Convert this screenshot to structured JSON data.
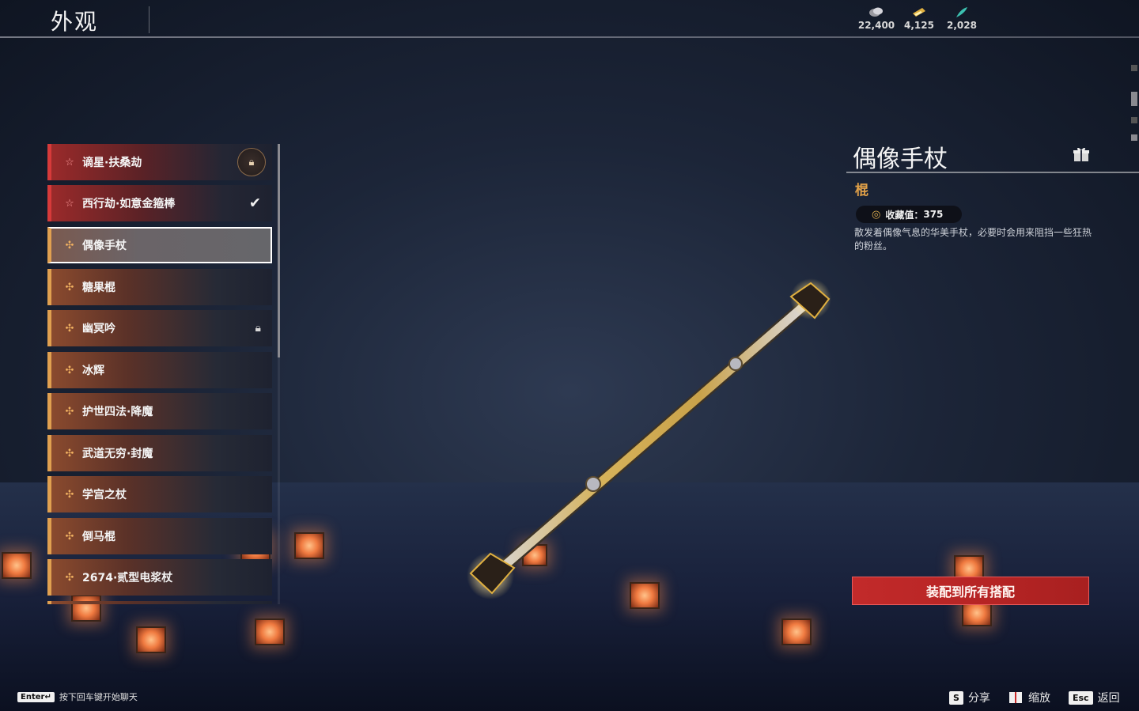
{
  "header": {
    "title": "外观",
    "currencies": [
      {
        "icon": "silver-coin-icon",
        "value": "22,400",
        "color": "#c8c8c8"
      },
      {
        "icon": "gold-ticket-icon",
        "value": "4,125",
        "color": "#e0b040"
      },
      {
        "icon": "cyan-feather-icon",
        "value": "2,028",
        "color": "#40c0b0"
      }
    ]
  },
  "list": {
    "items": [
      {
        "name": "谪星·扶桑劫",
        "marker": "star-icon",
        "status": "locked-circle"
      },
      {
        "name": "西行劫·如意金箍棒",
        "marker": "star-icon",
        "status": "equipped"
      },
      {
        "name": "偶像手杖",
        "marker": "cross-icon",
        "status": "selected"
      },
      {
        "name": "糖果棍",
        "marker": "cross-icon",
        "status": ""
      },
      {
        "name": "幽冥吟",
        "marker": "cross-icon",
        "status": "locked"
      },
      {
        "name": "冰辉",
        "marker": "cross-icon",
        "status": ""
      },
      {
        "name": "护世四法·降魔",
        "marker": "cross-icon",
        "status": ""
      },
      {
        "name": "武道无穷·封魔",
        "marker": "cross-icon",
        "status": ""
      },
      {
        "name": "学宫之杖",
        "marker": "cross-icon",
        "status": ""
      },
      {
        "name": "倒马棍",
        "marker": "cross-icon",
        "status": ""
      },
      {
        "name": "2674·贰型电浆杖",
        "marker": "cross-icon",
        "status": ""
      }
    ]
  },
  "detail": {
    "title": "偶像手杖",
    "type": "棍",
    "collection_label": "收藏值：",
    "collection_value": "375",
    "description": "散发着偶像气息的华美手杖，必要时会用来阻挡一些狂热的粉丝。",
    "equip_button": "装配到所有搭配"
  },
  "footer": {
    "chat_key": "Enter↵",
    "chat_hint": "按下回车键开始聊天",
    "share_key": "S",
    "share_label": "分享",
    "zoom_label": "缩放",
    "back_key": "Esc",
    "back_label": "返回"
  },
  "colors": {
    "accent_red": "#c22a2a",
    "accent_orange": "#e0a050",
    "type_color": "#e0a048"
  }
}
